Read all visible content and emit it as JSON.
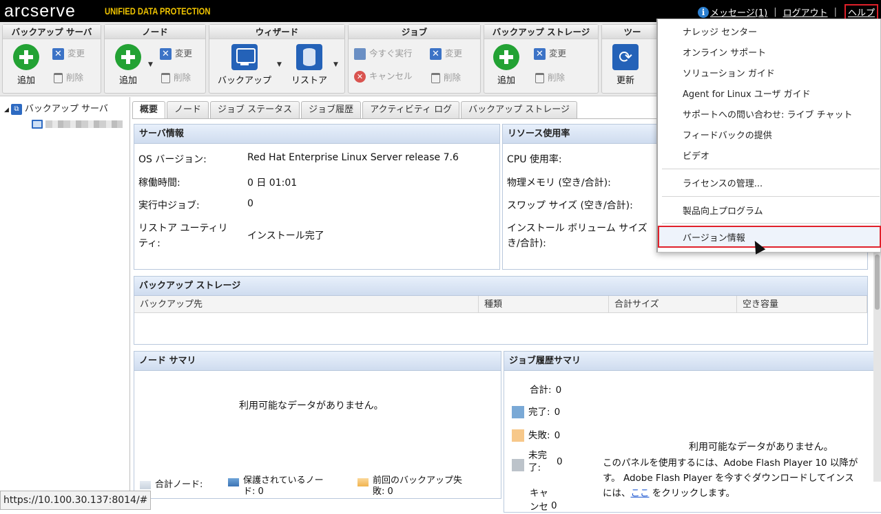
{
  "header": {
    "logo": "arcserve",
    "logo_sub": "UNIFIED DATA PROTECTION",
    "messages": "メッセージ(1)",
    "separator": "|",
    "logout": "ログアウト",
    "help": "ヘルプ"
  },
  "toolbar": {
    "backup_server": {
      "title": "バックアップ サーバ",
      "add": "追加",
      "modify": "変更",
      "delete": "削除"
    },
    "node": {
      "title": "ノード",
      "add": "追加",
      "modify": "変更",
      "delete": "削除"
    },
    "wizard": {
      "title": "ウィザード",
      "backup": "バックアップ",
      "restore": "リストア"
    },
    "job": {
      "title": "ジョブ",
      "run_now": "今すぐ実行",
      "modify": "変更",
      "cancel": "キャンセル",
      "delete": "削除"
    },
    "storage": {
      "title": "バックアップ ストレージ",
      "add": "追加",
      "modify": "変更",
      "delete": "削除"
    },
    "tools": {
      "title": "ツー",
      "refresh": "更新"
    }
  },
  "sidebar": {
    "root": "バックアップ サーバ"
  },
  "tabs": [
    "概要",
    "ノード",
    "ジョブ ステータス",
    "ジョブ履歴",
    "アクティビティ ログ",
    "バックアップ ストレージ"
  ],
  "server_info": {
    "title": "サーバ情報",
    "rows": [
      {
        "label": "OS バージョン:",
        "value": "Red Hat Enterprise Linux Server release 7.6"
      },
      {
        "label": "稼働時間:",
        "value": "0 日 01:01"
      },
      {
        "label": "実行中ジョブ:",
        "value": "0"
      },
      {
        "label": "リストア ユーティリティ:",
        "label_l1": "リストア ユーティリ",
        "label_l2": "ティ:",
        "value": "インストール完了"
      }
    ]
  },
  "resource_usage": {
    "title": "リソース使用率",
    "cpu": "CPU 使用率:",
    "memory": "物理メモリ (空き/合計):",
    "swap": "スワップ サイズ (空き/合計):",
    "volume_l1": "インストール ボリューム サイズ",
    "volume_l2": "き/合計):"
  },
  "backup_storage": {
    "title": "バックアップ ストレージ",
    "columns": [
      "バックアップ先",
      "種類",
      "合計サイズ",
      "空き容量"
    ]
  },
  "node_summary": {
    "title": "ノード サマリ",
    "no_data": "利用可能なデータがありません。",
    "legend_total": "合計ノード:",
    "legend_protected_l1": "保護されているノー",
    "legend_protected_l2": "ド: 0",
    "legend_failed_l1": "前回のバックアップ失",
    "legend_failed_l2": "敗: 0"
  },
  "job_history_summary": {
    "title": "ジョブ履歴サマリ",
    "total_label": "合計:",
    "total_value": "0",
    "done_label": "完了:",
    "done_value": "0",
    "failed_label": "失敗:",
    "failed_value": "0",
    "incomplete_l1": "未完",
    "incomplete_l2": "了:",
    "incomplete_value": "0",
    "cancel_l1": "キャ",
    "cancel_l2": "ンセ",
    "cancel_value": "0",
    "no_data": "利用可能なデータがありません。",
    "flash_l1": "このパネルを使用するには、Adobe Flash Player 10 以降が",
    "flash_l2": "す。 Adobe Flash Player を今すぐダウンロードしてインス",
    "flash_l3a": "には、",
    "flash_link": "ここ",
    "flash_l3b": " をクリックします。",
    "colors": {
      "done": "#7aa9d6",
      "failed": "#f7c88a",
      "incomplete": "#bcc3ca"
    }
  },
  "help_menu": {
    "items": [
      "ナレッジ センター",
      "オンライン サポート",
      "ソリューション ガイド",
      "Agent for Linux ユーザ ガイド",
      "サポートへの問い合わせ: ライブ チャット",
      "フィードバックの提供",
      "ビデオ",
      "ライセンスの管理...",
      "製品向上プログラム",
      "バージョン情報"
    ]
  },
  "status_url": "https://10.100.30.137:8014/#"
}
